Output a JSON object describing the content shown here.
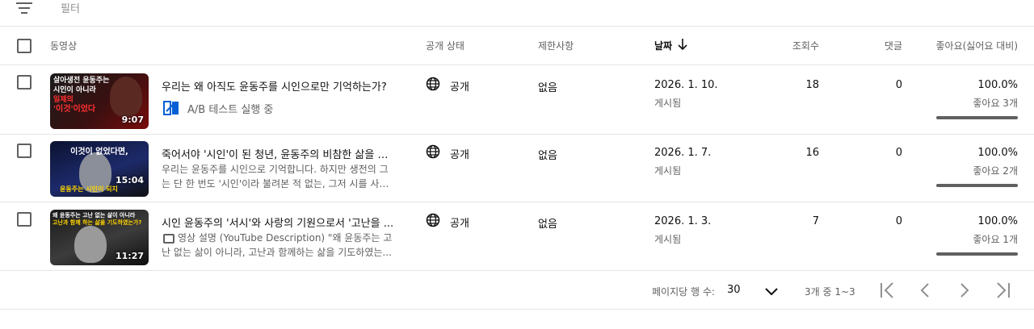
{
  "filter": {
    "label": "필터",
    "icon": "filter-lines-icon"
  },
  "columns": {
    "video": "동영상",
    "visibility": "공개 상태",
    "restrictions": "제한사항",
    "date": "날짜",
    "views": "조회수",
    "comments": "댓글",
    "likes": "좋아요(싫어요 대비)"
  },
  "sort": {
    "column": "date",
    "direction": "descending",
    "icon": "arrow-down-icon"
  },
  "rows": [
    {
      "thumbnail": {
        "lines": [
          "살아생전 윤동주는",
          "시인이 아니라",
          "일제의",
          "'이것'이었다"
        ],
        "duration": "9:07"
      },
      "title": "우리는 왜 아직도 윤동주를 시인으로만 기억하는가?",
      "ab_test": "A/B 테스트 실행 중",
      "visibility": "공개",
      "restrictions": "없음",
      "date": "2026. 1. 10.",
      "date_status": "게시됨",
      "views": "18",
      "comments": "0",
      "likes_pct": "100.0%",
      "likes_count": "좋아요 3개",
      "likes_ratio": 1.0
    },
    {
      "thumbnail": {
        "lines": [
          "이것이 없었다면,",
          "윤동주는 시인이 되지"
        ],
        "duration": "15:04"
      },
      "title": "죽어서야 '시인'이 된 청년, 윤동주의 비참한 삶을 다...",
      "description": [
        "우리는 윤동주를 시인으로 기억합니다. 하지만 생전의 그",
        "는 단 한 번도 '시인'이라 불려본 적 없는, 그저 시를 사랑..."
      ],
      "visibility": "공개",
      "restrictions": "없음",
      "date": "2026. 1. 7.",
      "date_status": "게시됨",
      "views": "16",
      "comments": "0",
      "likes_pct": "100.0%",
      "likes_count": "좋아요 2개",
      "likes_ratio": 1.0
    },
    {
      "thumbnail": {
        "lines": [
          "왜 윤동주는 고난 없는 삶이 아니라",
          "고난과 함께 하는 삶을 기도하였는가?"
        ],
        "duration": "11:27"
      },
      "title": "시인 윤동주의 '서시'와 사랑의 기원으로서 '고난을 ...",
      "description_icon": "video-description-icon",
      "description": [
        "영상 설명 (YouTube Description) \"왜 윤동주는 고",
        "난 없는 삶이 아니라, 고난과 함께하는 삶을 기도하였는..."
      ],
      "visibility": "공개",
      "restrictions": "없음",
      "date": "2026. 1. 3.",
      "date_status": "게시됨",
      "views": "7",
      "comments": "0",
      "likes_pct": "100.0%",
      "likes_count": "좋아요 1개",
      "likes_ratio": 1.0
    }
  ],
  "pagination": {
    "rows_per_page_label": "페이지당 행 수:",
    "rows_per_page": "30",
    "range": "3개 중 1~3"
  }
}
